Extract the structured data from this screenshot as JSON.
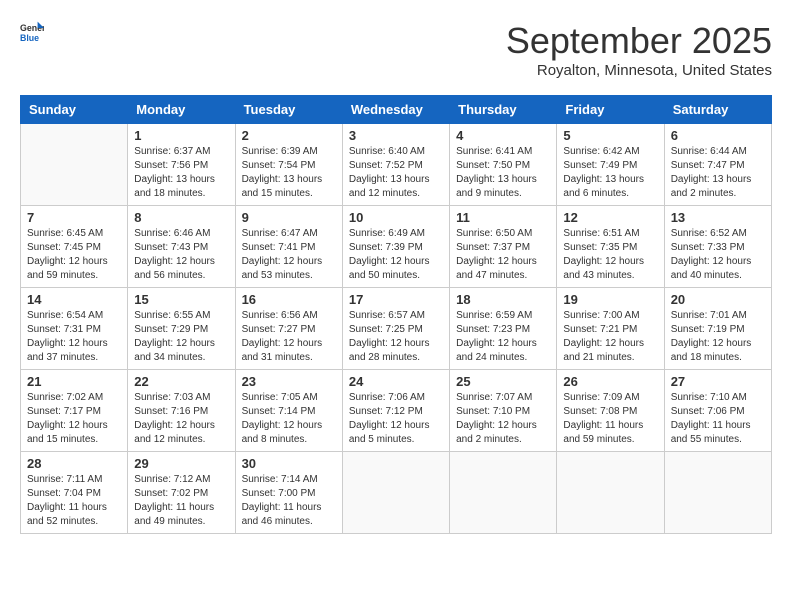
{
  "header": {
    "logo_general": "General",
    "logo_blue": "Blue",
    "title": "September 2025",
    "subtitle": "Royalton, Minnesota, United States"
  },
  "weekdays": [
    "Sunday",
    "Monday",
    "Tuesday",
    "Wednesday",
    "Thursday",
    "Friday",
    "Saturday"
  ],
  "weeks": [
    [
      {
        "day": "",
        "empty": true
      },
      {
        "day": "1",
        "sunrise": "Sunrise: 6:37 AM",
        "sunset": "Sunset: 7:56 PM",
        "daylight": "Daylight: 13 hours and 18 minutes."
      },
      {
        "day": "2",
        "sunrise": "Sunrise: 6:39 AM",
        "sunset": "Sunset: 7:54 PM",
        "daylight": "Daylight: 13 hours and 15 minutes."
      },
      {
        "day": "3",
        "sunrise": "Sunrise: 6:40 AM",
        "sunset": "Sunset: 7:52 PM",
        "daylight": "Daylight: 13 hours and 12 minutes."
      },
      {
        "day": "4",
        "sunrise": "Sunrise: 6:41 AM",
        "sunset": "Sunset: 7:50 PM",
        "daylight": "Daylight: 13 hours and 9 minutes."
      },
      {
        "day": "5",
        "sunrise": "Sunrise: 6:42 AM",
        "sunset": "Sunset: 7:49 PM",
        "daylight": "Daylight: 13 hours and 6 minutes."
      },
      {
        "day": "6",
        "sunrise": "Sunrise: 6:44 AM",
        "sunset": "Sunset: 7:47 PM",
        "daylight": "Daylight: 13 hours and 2 minutes."
      }
    ],
    [
      {
        "day": "7",
        "sunrise": "Sunrise: 6:45 AM",
        "sunset": "Sunset: 7:45 PM",
        "daylight": "Daylight: 12 hours and 59 minutes."
      },
      {
        "day": "8",
        "sunrise": "Sunrise: 6:46 AM",
        "sunset": "Sunset: 7:43 PM",
        "daylight": "Daylight: 12 hours and 56 minutes."
      },
      {
        "day": "9",
        "sunrise": "Sunrise: 6:47 AM",
        "sunset": "Sunset: 7:41 PM",
        "daylight": "Daylight: 12 hours and 53 minutes."
      },
      {
        "day": "10",
        "sunrise": "Sunrise: 6:49 AM",
        "sunset": "Sunset: 7:39 PM",
        "daylight": "Daylight: 12 hours and 50 minutes."
      },
      {
        "day": "11",
        "sunrise": "Sunrise: 6:50 AM",
        "sunset": "Sunset: 7:37 PM",
        "daylight": "Daylight: 12 hours and 47 minutes."
      },
      {
        "day": "12",
        "sunrise": "Sunrise: 6:51 AM",
        "sunset": "Sunset: 7:35 PM",
        "daylight": "Daylight: 12 hours and 43 minutes."
      },
      {
        "day": "13",
        "sunrise": "Sunrise: 6:52 AM",
        "sunset": "Sunset: 7:33 PM",
        "daylight": "Daylight: 12 hours and 40 minutes."
      }
    ],
    [
      {
        "day": "14",
        "sunrise": "Sunrise: 6:54 AM",
        "sunset": "Sunset: 7:31 PM",
        "daylight": "Daylight: 12 hours and 37 minutes."
      },
      {
        "day": "15",
        "sunrise": "Sunrise: 6:55 AM",
        "sunset": "Sunset: 7:29 PM",
        "daylight": "Daylight: 12 hours and 34 minutes."
      },
      {
        "day": "16",
        "sunrise": "Sunrise: 6:56 AM",
        "sunset": "Sunset: 7:27 PM",
        "daylight": "Daylight: 12 hours and 31 minutes."
      },
      {
        "day": "17",
        "sunrise": "Sunrise: 6:57 AM",
        "sunset": "Sunset: 7:25 PM",
        "daylight": "Daylight: 12 hours and 28 minutes."
      },
      {
        "day": "18",
        "sunrise": "Sunrise: 6:59 AM",
        "sunset": "Sunset: 7:23 PM",
        "daylight": "Daylight: 12 hours and 24 minutes."
      },
      {
        "day": "19",
        "sunrise": "Sunrise: 7:00 AM",
        "sunset": "Sunset: 7:21 PM",
        "daylight": "Daylight: 12 hours and 21 minutes."
      },
      {
        "day": "20",
        "sunrise": "Sunrise: 7:01 AM",
        "sunset": "Sunset: 7:19 PM",
        "daylight": "Daylight: 12 hours and 18 minutes."
      }
    ],
    [
      {
        "day": "21",
        "sunrise": "Sunrise: 7:02 AM",
        "sunset": "Sunset: 7:17 PM",
        "daylight": "Daylight: 12 hours and 15 minutes."
      },
      {
        "day": "22",
        "sunrise": "Sunrise: 7:03 AM",
        "sunset": "Sunset: 7:16 PM",
        "daylight": "Daylight: 12 hours and 12 minutes."
      },
      {
        "day": "23",
        "sunrise": "Sunrise: 7:05 AM",
        "sunset": "Sunset: 7:14 PM",
        "daylight": "Daylight: 12 hours and 8 minutes."
      },
      {
        "day": "24",
        "sunrise": "Sunrise: 7:06 AM",
        "sunset": "Sunset: 7:12 PM",
        "daylight": "Daylight: 12 hours and 5 minutes."
      },
      {
        "day": "25",
        "sunrise": "Sunrise: 7:07 AM",
        "sunset": "Sunset: 7:10 PM",
        "daylight": "Daylight: 12 hours and 2 minutes."
      },
      {
        "day": "26",
        "sunrise": "Sunrise: 7:09 AM",
        "sunset": "Sunset: 7:08 PM",
        "daylight": "Daylight: 11 hours and 59 minutes."
      },
      {
        "day": "27",
        "sunrise": "Sunrise: 7:10 AM",
        "sunset": "Sunset: 7:06 PM",
        "daylight": "Daylight: 11 hours and 55 minutes."
      }
    ],
    [
      {
        "day": "28",
        "sunrise": "Sunrise: 7:11 AM",
        "sunset": "Sunset: 7:04 PM",
        "daylight": "Daylight: 11 hours and 52 minutes."
      },
      {
        "day": "29",
        "sunrise": "Sunrise: 7:12 AM",
        "sunset": "Sunset: 7:02 PM",
        "daylight": "Daylight: 11 hours and 49 minutes."
      },
      {
        "day": "30",
        "sunrise": "Sunrise: 7:14 AM",
        "sunset": "Sunset: 7:00 PM",
        "daylight": "Daylight: 11 hours and 46 minutes."
      },
      {
        "day": "",
        "empty": true
      },
      {
        "day": "",
        "empty": true
      },
      {
        "day": "",
        "empty": true
      },
      {
        "day": "",
        "empty": true
      }
    ]
  ]
}
